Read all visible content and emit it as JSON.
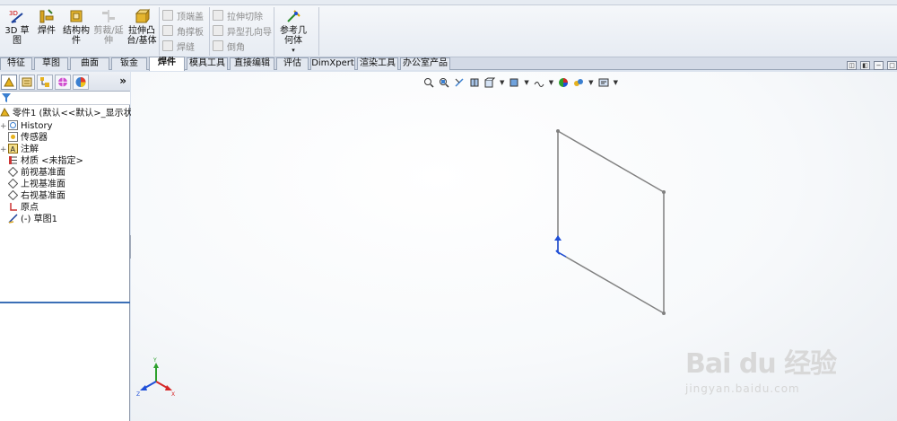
{
  "ribbon": {
    "buttons": [
      {
        "label_line1": "3D 草图",
        "label_line2": ""
      },
      {
        "label_line1": "焊件",
        "label_line2": ""
      },
      {
        "label_line1": "结构构",
        "label_line2": "件"
      },
      {
        "label_line1": "剪裁/延",
        "label_line2": "伸"
      },
      {
        "label_line1": "拉伸凸",
        "label_line2": "台/基体"
      }
    ],
    "group1": [
      "顶端盖",
      "角撑板",
      "焊缝"
    ],
    "group2": [
      "拉伸切除",
      "异型孔向导",
      "倒角"
    ],
    "ref_geometry": {
      "line1": "参考几",
      "line2": "何体",
      "caret": "▾"
    }
  },
  "tabs": [
    "特征",
    "草图",
    "曲面",
    "钣金",
    "焊件",
    "模具工具",
    "直接编辑",
    "评估",
    "DimXpert",
    "渲染工具",
    "办公室产品"
  ],
  "active_tab": "焊件",
  "feature_tree": {
    "more": "»",
    "items": [
      {
        "label": "零件1 (默认<<默认>_显示状态",
        "icon": "part-icon",
        "expand": ""
      },
      {
        "label": "History",
        "icon": "history-icon",
        "expand": "+"
      },
      {
        "label": "传感器",
        "icon": "sensor-icon",
        "expand": ""
      },
      {
        "label": "注解",
        "icon": "annotation-icon",
        "expand": "+"
      },
      {
        "label": "材质 <未指定>",
        "icon": "material-icon",
        "expand": ""
      },
      {
        "label": "前视基准面",
        "icon": "plane-icon",
        "expand": ""
      },
      {
        "label": "上视基准面",
        "icon": "plane-icon",
        "expand": ""
      },
      {
        "label": "右视基准面",
        "icon": "plane-icon",
        "expand": ""
      },
      {
        "label": "原点",
        "icon": "origin-icon",
        "expand": ""
      },
      {
        "label": "(-) 草图1",
        "icon": "sketch-icon",
        "expand": ""
      }
    ]
  },
  "watermark": {
    "brand": "Bai du 经验",
    "url": "jingyan.baidu.com"
  },
  "colors": {
    "sketch": "#7f7f7f",
    "origin": "#1f4fd8",
    "active_rule": "#3b6fb6"
  }
}
